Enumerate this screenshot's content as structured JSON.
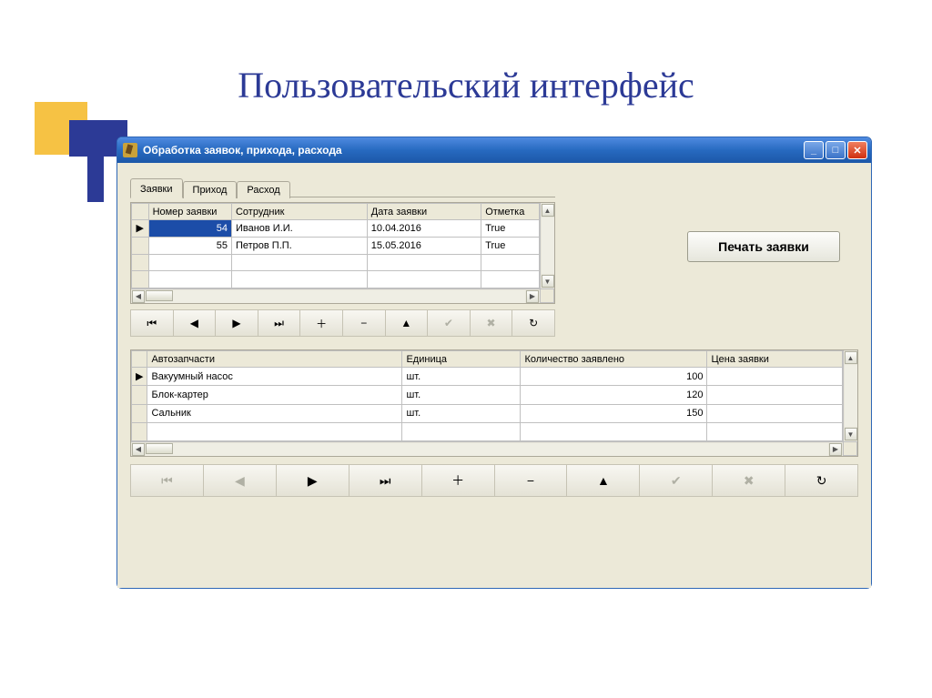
{
  "slide": {
    "title": "Пользовательский интерфейс"
  },
  "window": {
    "title": "Обработка заявок, прихода, расхода"
  },
  "tabs": {
    "items": [
      {
        "label": "Заявки",
        "active": true
      },
      {
        "label": "Приход",
        "active": false
      },
      {
        "label": "Расход",
        "active": false
      }
    ]
  },
  "buttons": {
    "print": "Печать заявки"
  },
  "grid1": {
    "headers": {
      "num": "Номер заявки",
      "emp": "Сотрудник",
      "date": "Дата заявки",
      "mark": "Отметка"
    },
    "rows": [
      {
        "num": "54",
        "emp": "Иванов И.И.",
        "date": "10.04.2016",
        "mark": "True",
        "current": true,
        "selected_col": "num"
      },
      {
        "num": "55",
        "emp": "Петров П.П.",
        "date": "15.05.2016",
        "mark": "True",
        "current": false
      }
    ]
  },
  "grid2": {
    "headers": {
      "part": "Автозапчасти",
      "unit": "Единица",
      "qty": "Количество заявлено",
      "price": "Цена заявки"
    },
    "rows": [
      {
        "part": "Вакуумный насос",
        "unit": "шт.",
        "qty": "100",
        "price": "",
        "current": true
      },
      {
        "part": "Блок-картер",
        "unit": "шт.",
        "qty": "120",
        "price": "",
        "current": false
      },
      {
        "part": "Сальник",
        "unit": "шт.",
        "qty": "150",
        "price": "",
        "current": false
      }
    ]
  },
  "nav": {
    "first": "⏮",
    "prev": "◀",
    "next": "▶",
    "last": "⏭",
    "add": "＋",
    "del": "−",
    "edit": "▲",
    "post": "✔",
    "cancel": "✖",
    "refresh": "↻"
  }
}
